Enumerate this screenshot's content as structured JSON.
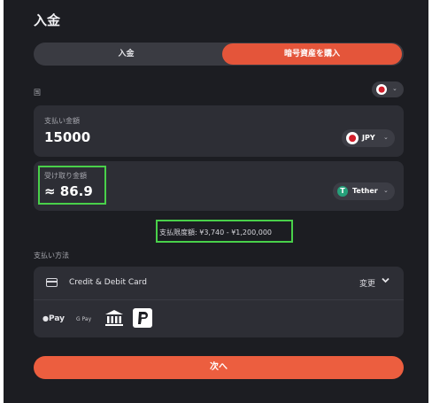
{
  "header": {
    "title": "入金"
  },
  "tabs": [
    {
      "label": "入金",
      "active": false
    },
    {
      "label": "暗号資産を購入",
      "active": true
    }
  ],
  "country": {
    "label": "国",
    "flag": "japan-flag-icon"
  },
  "pay": {
    "label": "支払い金額",
    "amount": "15000",
    "currency": "JPY"
  },
  "receive": {
    "label": "受け取り金額",
    "amount": "≈ 86.9",
    "currency": "Tether"
  },
  "limit": {
    "text": "支払限度額: ¥3,740 - ¥1,200,000"
  },
  "payment_method": {
    "label": "支払い方法",
    "selected": "Credit & Debit Card",
    "change_label": "変更",
    "apple_pay": "Pay",
    "google_pay": "G Pay"
  },
  "next_button": {
    "label": "次へ"
  },
  "colors": {
    "background": "#1c1d22",
    "card": "#2d2e35",
    "accent": "#e4553a",
    "highlight": "#49d04a"
  }
}
